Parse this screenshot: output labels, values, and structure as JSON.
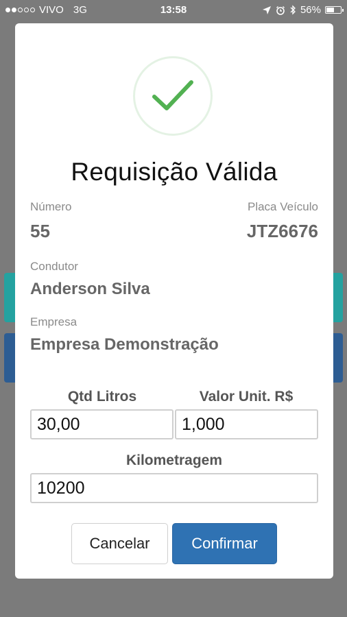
{
  "status_bar": {
    "carrier": "VIVO",
    "network": "3G",
    "time": "13:58",
    "battery": "56%",
    "battery_level": 0.56,
    "icons": [
      "location-arrow-icon",
      "alarm-clock-icon",
      "bluetooth-icon"
    ]
  },
  "modal": {
    "title": "Requisição Válida",
    "success_icon": "checkmark-icon",
    "numero": {
      "label": "Número",
      "value": "55"
    },
    "placa": {
      "label": "Placa Veículo",
      "value": "JTZ6676"
    },
    "condutor": {
      "label": "Condutor",
      "value": "Anderson Silva"
    },
    "empresa": {
      "label": "Empresa",
      "value": "Empresa Demonstração"
    },
    "fields": {
      "litros": {
        "label": "Qtd Litros",
        "value": "30,00"
      },
      "valor": {
        "label": "Valor Unit. R$",
        "value": "1,000"
      },
      "km": {
        "label": "Kilometragem",
        "value": "10200"
      }
    },
    "buttons": {
      "cancel": "Cancelar",
      "confirm": "Confirmar"
    }
  },
  "colors": {
    "success": "#52b152",
    "primary": "#2f72b3",
    "teal": "#24a2a0",
    "navy": "#2d5d93",
    "overlay": "#7b7b7b"
  }
}
